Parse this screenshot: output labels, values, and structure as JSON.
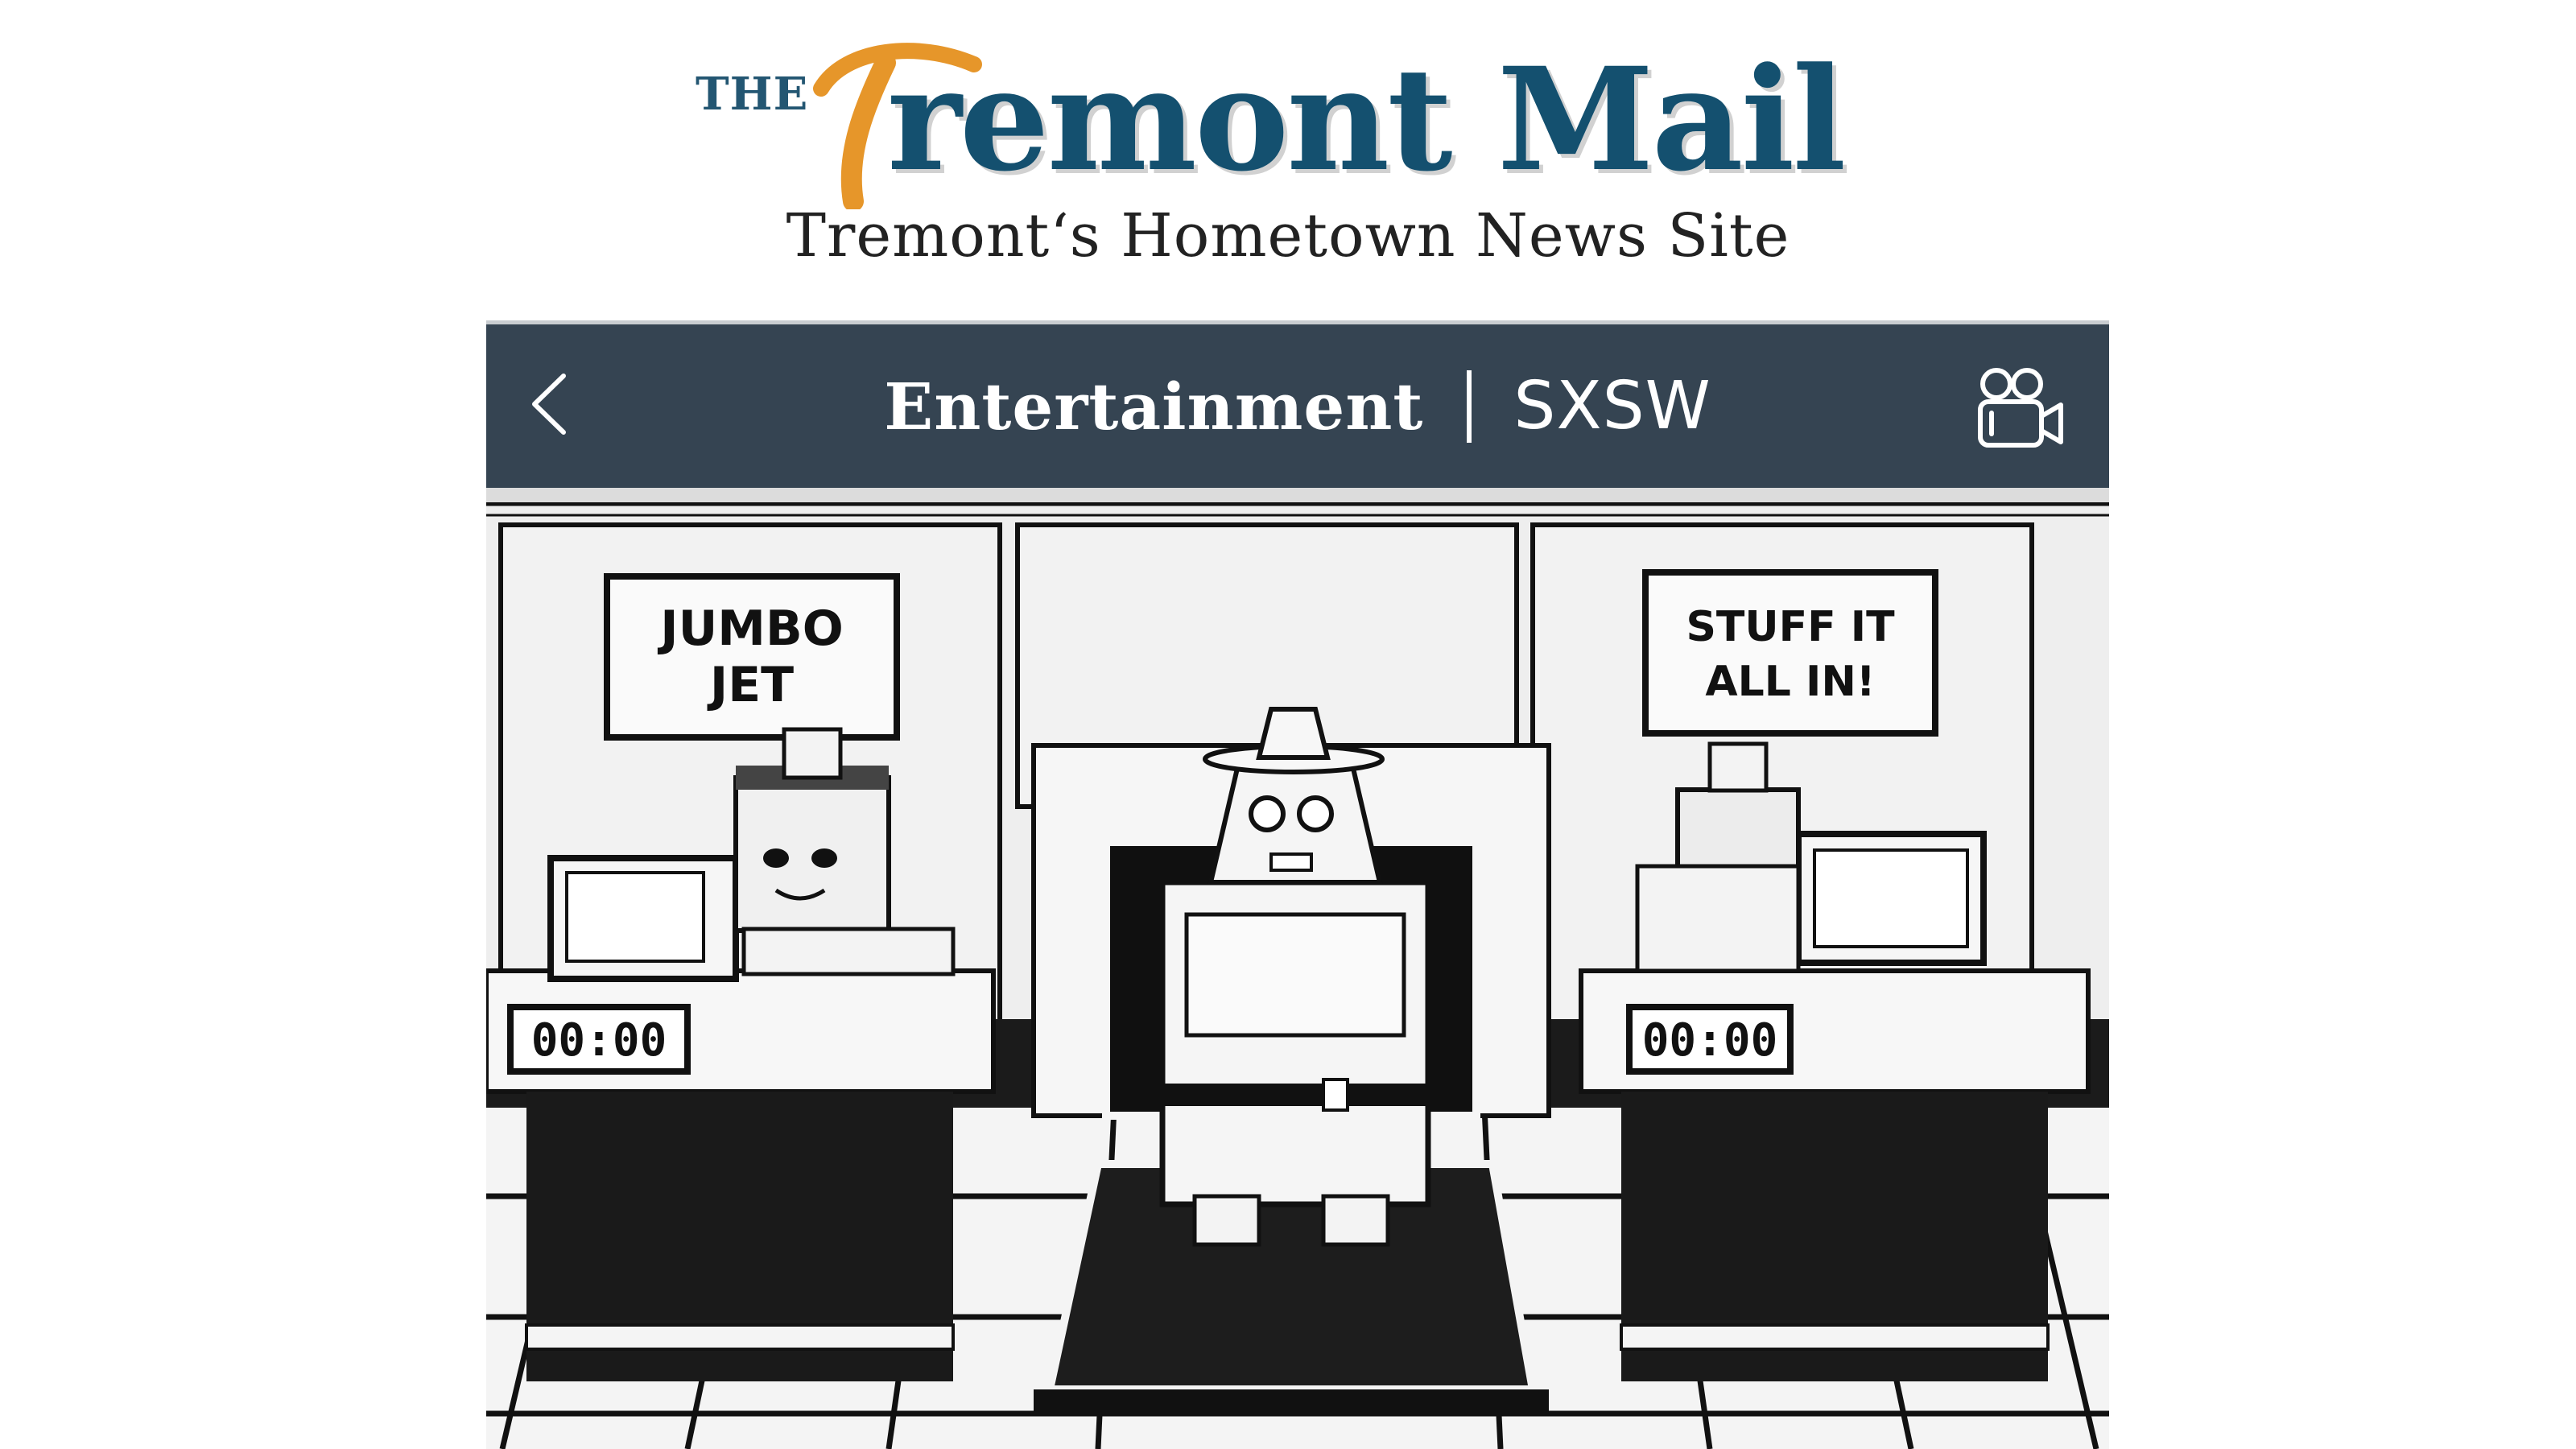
{
  "masthead": {
    "logo_the": "THE",
    "logo_name": "remont Mail",
    "logo_initial": "T",
    "tagline": "Tremont‘s Hometown News Site"
  },
  "section_bar": {
    "back_icon": "chevron-left-icon",
    "primary": "Entertainment",
    "secondary": "SXSW",
    "video_icon": "video-camera-icon"
  },
  "hero": {
    "sign_left_line1": "JUMBO",
    "sign_left_line2": "JET",
    "sign_right_line1": "STUFF IT",
    "sign_right_line2": "ALL IN!",
    "counter_left": "00:00",
    "counter_right": "00:00"
  },
  "colors": {
    "brand_blue": "#14506f",
    "brand_orange": "#e6962a",
    "nav_bg": "#354452"
  }
}
